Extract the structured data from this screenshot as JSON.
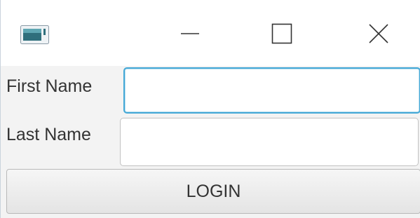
{
  "window": {
    "title": "",
    "controls": {
      "minimize_icon": "minimize-icon",
      "maximize_icon": "maximize-icon",
      "close_icon": "close-icon"
    }
  },
  "form": {
    "first_name_label": "First Name",
    "first_name_value": "",
    "last_name_label": "Last Name",
    "last_name_value": "",
    "login_label": "LOGIN"
  },
  "colors": {
    "focus_border": "#44a8d6",
    "background": "#f3f3f3",
    "titlebar": "#ffffff"
  }
}
